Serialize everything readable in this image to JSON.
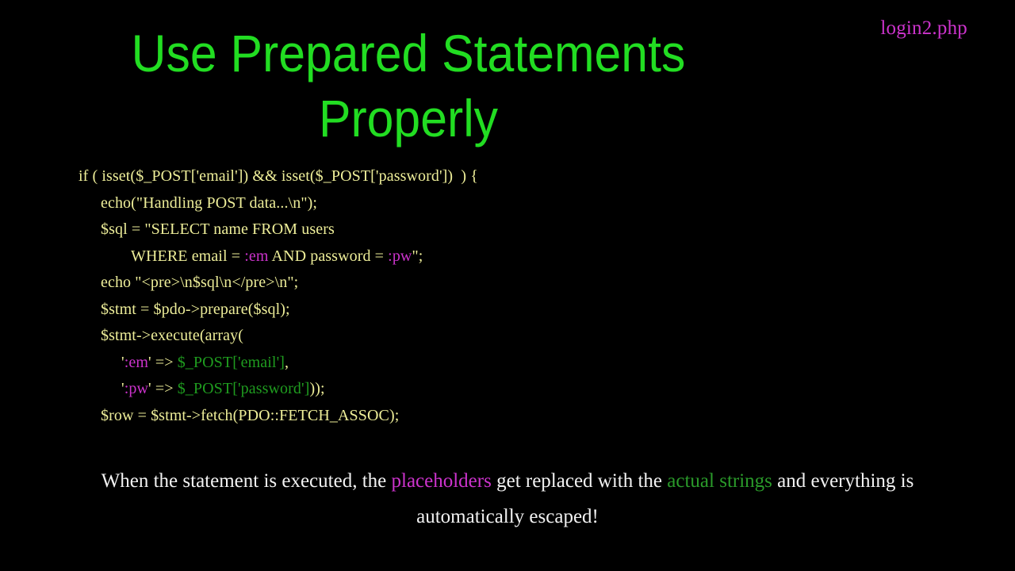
{
  "slide": {
    "label": "login2.php",
    "title_line1": "Use Prepared Statements",
    "title_line2": "Properly",
    "colors": {
      "background": "#000000",
      "title_green": "#22dd22",
      "label_magenta": "#cc33cc",
      "code_yellow": "#eeee99",
      "code_placeholder_magenta": "#cc33cc",
      "code_variable_green": "#1f9c1f",
      "caption_white": "#f2f2f2",
      "caption_green": "#2a9a2a"
    }
  },
  "code": {
    "language": "php",
    "lines": [
      {
        "indent": 0,
        "parts": [
          {
            "text": "if ( isset($_POST['email']) && isset($_POST['password'])  ) {",
            "style": "plain"
          }
        ]
      },
      {
        "indent": 1,
        "parts": [
          {
            "text": "echo(\"Handling POST data...\\n\");",
            "style": "plain"
          }
        ]
      },
      {
        "indent": 1,
        "parts": [
          {
            "text": "$sql = \"SELECT name FROM users",
            "style": "plain"
          }
        ]
      },
      {
        "indent": 3,
        "parts": [
          {
            "text": "WHERE email = ",
            "style": "plain"
          },
          {
            "text": ":em",
            "style": "placeholder"
          },
          {
            "text": " AND password = ",
            "style": "plain"
          },
          {
            "text": ":pw",
            "style": "placeholder"
          },
          {
            "text": "\";",
            "style": "plain"
          }
        ]
      },
      {
        "indent": 1,
        "parts": [
          {
            "text": "echo \"<pre>\\n$sql\\n</pre>\\n\";",
            "style": "plain"
          }
        ]
      },
      {
        "indent": 1,
        "parts": [
          {
            "text": "$stmt = $pdo->prepare($sql);",
            "style": "plain"
          }
        ]
      },
      {
        "indent": 1,
        "parts": [
          {
            "text": "$stmt->execute(array(",
            "style": "plain"
          }
        ]
      },
      {
        "indent": 2,
        "parts": [
          {
            "text": "'",
            "style": "plain"
          },
          {
            "text": ":em",
            "style": "placeholder"
          },
          {
            "text": "' => ",
            "style": "plain"
          },
          {
            "text": "$_POST['email']",
            "style": "variable"
          },
          {
            "text": ",",
            "style": "plain"
          }
        ]
      },
      {
        "indent": 2,
        "parts": [
          {
            "text": "'",
            "style": "plain"
          },
          {
            "text": ":pw",
            "style": "placeholder"
          },
          {
            "text": "' => ",
            "style": "plain"
          },
          {
            "text": "$_POST['password']",
            "style": "variable"
          },
          {
            "text": "));",
            "style": "plain"
          }
        ]
      },
      {
        "indent": 1,
        "parts": [
          {
            "text": "$row = $stmt->fetch(PDO::FETCH_ASSOC);",
            "style": "plain"
          }
        ]
      }
    ]
  },
  "caption": {
    "segment1": "When the statement is executed, the ",
    "highlight_placeholders": "placeholders",
    "segment2": " get replaced with the ",
    "highlight_strings": "actual strings",
    "segment3": " and everything is automatically escaped!"
  }
}
